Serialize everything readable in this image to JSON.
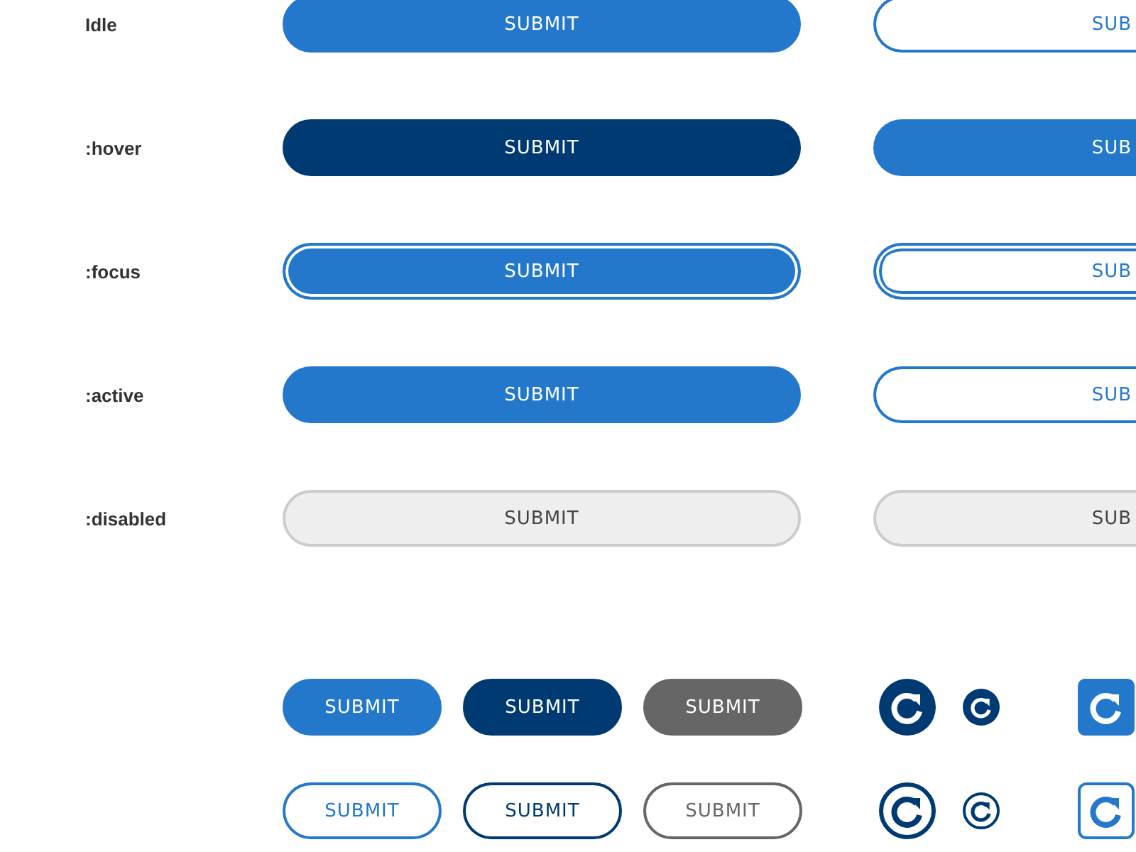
{
  "states": [
    {
      "label": "Idle",
      "main": {
        "label": "SUBMIT",
        "kind": "filled"
      },
      "side": {
        "label": "SUB",
        "kind": "outline"
      }
    },
    {
      "label": ":hover",
      "main": {
        "label": "SUBMIT",
        "kind": "dark"
      },
      "side": {
        "label": "SUB",
        "kind": "filled"
      }
    },
    {
      "label": ":focus",
      "main": {
        "label": "SUBMIT",
        "kind": "focused"
      },
      "side": {
        "label": "SUB",
        "kind": "ringed"
      }
    },
    {
      "label": ":active",
      "main": {
        "label": "SUBMIT",
        "kind": "filled"
      },
      "side": {
        "label": "SUB",
        "kind": "outline"
      }
    },
    {
      "label": ":disabled",
      "main": {
        "label": "SUBMIT",
        "kind": "disabled"
      },
      "side": {
        "label": "SUB",
        "kind": "disabled"
      }
    }
  ],
  "variants": [
    {
      "buttons": [
        {
          "label": "SUBMIT",
          "kind": "solid",
          "color": "#2478cc"
        },
        {
          "label": "SUBMIT",
          "kind": "solid",
          "color": "#003a72"
        },
        {
          "label": "SUBMIT",
          "kind": "solid",
          "color": "#666666"
        }
      ],
      "icon_buttons": [
        {
          "kind": "disc",
          "color": "#003a72"
        },
        {
          "kind": "dot",
          "color": "#003a72"
        },
        {
          "kind": "tile",
          "color": "#2478cc"
        }
      ]
    },
    {
      "buttons": [
        {
          "label": "SUBMIT",
          "kind": "outline",
          "color": "#2478cc"
        },
        {
          "label": "SUBMIT",
          "kind": "outline",
          "color": "#003a72"
        },
        {
          "label": "SUBMIT",
          "kind": "outline",
          "color": "#666666"
        }
      ],
      "icon_buttons": [
        {
          "kind": "ring",
          "color": "#003a72"
        },
        {
          "kind": "loop",
          "color": "#003a72"
        },
        {
          "kind": "frame",
          "color": "#2478cc"
        }
      ]
    }
  ]
}
